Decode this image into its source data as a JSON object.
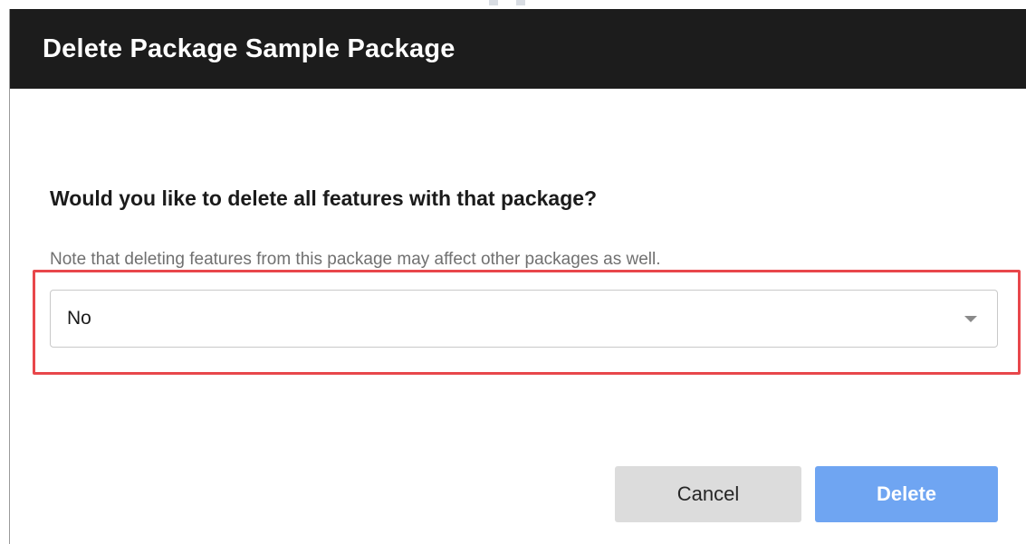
{
  "dialog": {
    "title": "Delete Package Sample Package",
    "question": "Would you like to delete all features with that package?",
    "note": "Note that deleting features from this package may affect other packages as well.",
    "select": {
      "value": "No",
      "icon": "chevron-down-icon"
    },
    "buttons": {
      "cancel_label": "Cancel",
      "delete_label": "Delete"
    }
  },
  "colors": {
    "header_bg": "#1c1c1c",
    "highlight_border": "#e8474b",
    "delete_button": "#6fa5f2",
    "cancel_button": "#dcdcdc"
  }
}
